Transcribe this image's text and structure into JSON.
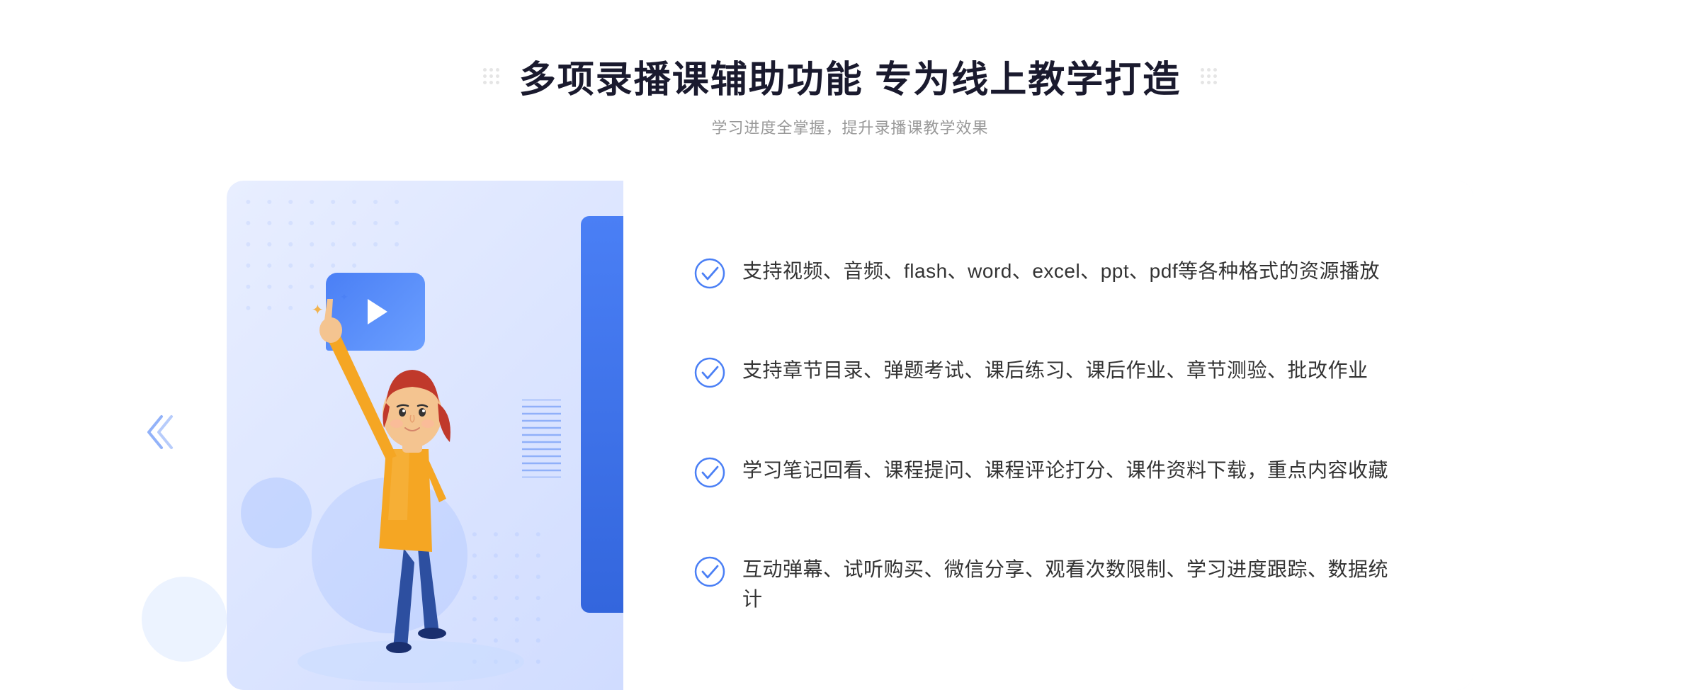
{
  "header": {
    "title": "多项录播课辅助功能 专为线上教学打造",
    "subtitle": "学习进度全掌握，提升录播课教学效果",
    "decorative_dots_left": "dots-left",
    "decorative_dots_right": "dots-right"
  },
  "features": [
    {
      "id": 1,
      "text": "支持视频、音频、flash、word、excel、ppt、pdf等各种格式的资源播放"
    },
    {
      "id": 2,
      "text": "支持章节目录、弹题考试、课后练习、课后作业、章节测验、批改作业"
    },
    {
      "id": 3,
      "text": "学习笔记回看、课程提问、课程评论打分、课件资料下载，重点内容收藏"
    },
    {
      "id": 4,
      "text": "互动弹幕、试听购买、微信分享、观看次数限制、学习进度跟踪、数据统计"
    }
  ],
  "colors": {
    "primary_blue": "#4a7ff5",
    "title_dark": "#1a1a2e",
    "subtitle_gray": "#999999",
    "feature_text": "#333333",
    "card_bg": "#f5f8ff",
    "illustration_bg": "#dde8ff"
  },
  "chevron_symbol": "»",
  "play_icon": "▶"
}
